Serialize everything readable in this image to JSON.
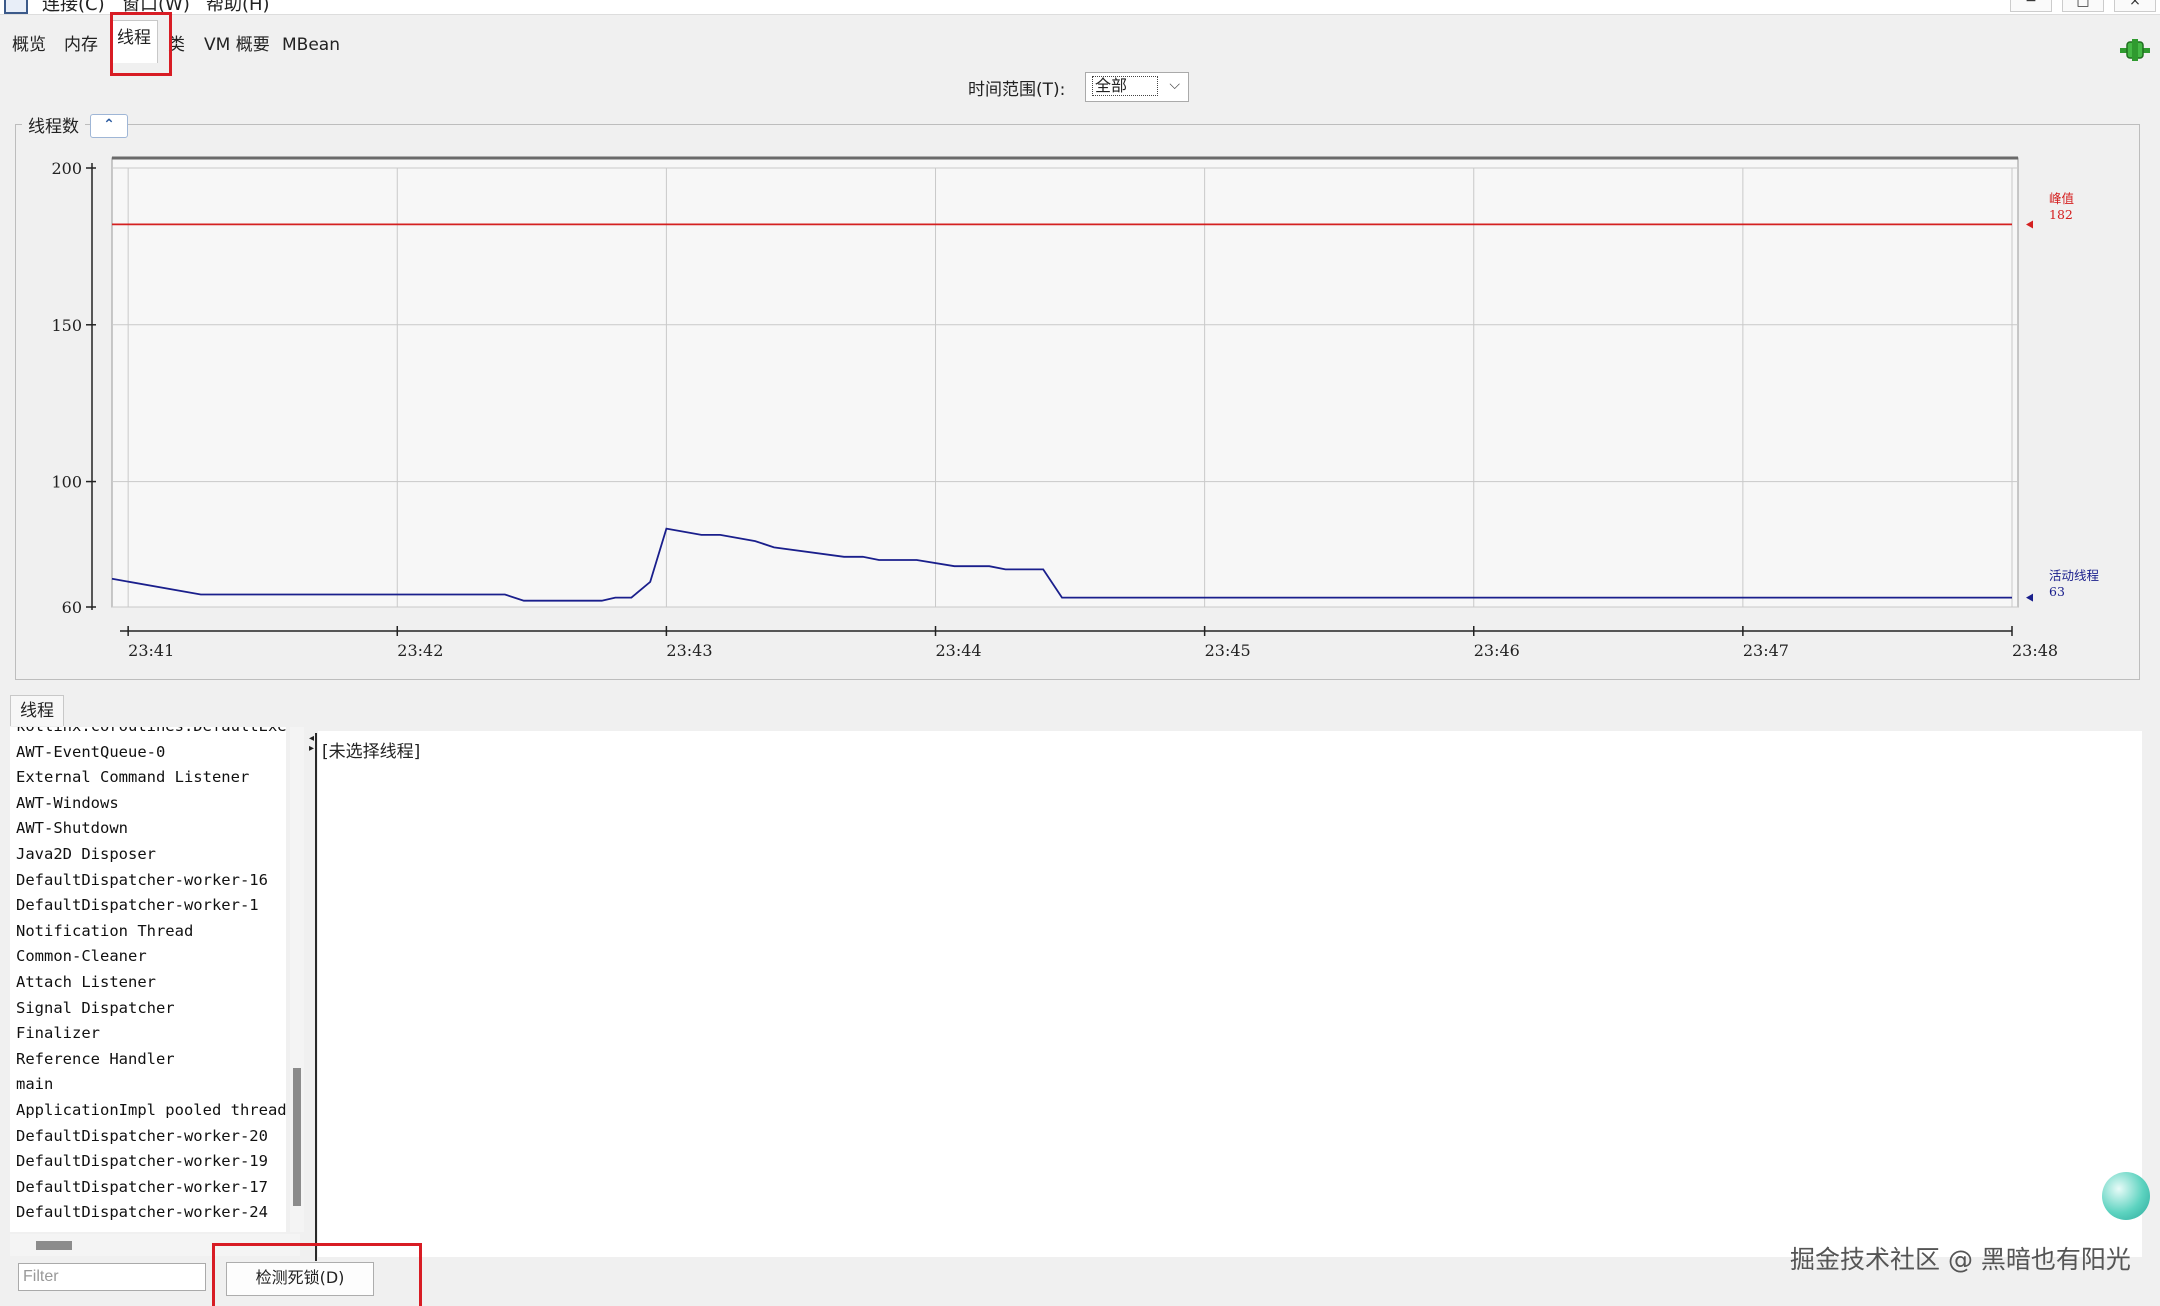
{
  "menubar": {
    "items": [
      "连接(C)",
      "窗口(W)",
      "帮助(H)"
    ],
    "window_buttons": [
      "−",
      "□",
      "×"
    ]
  },
  "tabs": [
    {
      "label": "概览"
    },
    {
      "label": "内存"
    },
    {
      "label": "线程"
    },
    {
      "label": "类"
    },
    {
      "label": "VM 概要"
    },
    {
      "label": "MBean"
    }
  ],
  "active_tab": "线程",
  "time_range": {
    "label": "时间范围(T):",
    "value": "全部"
  },
  "chart_panel": {
    "legend": "线程数",
    "collapse_icon": "double-chevron-up-icon"
  },
  "chart_data": {
    "type": "line",
    "title": "线程数",
    "xlabel": "",
    "ylabel": "",
    "yticks": [
      60,
      100,
      150,
      200
    ],
    "ylim": [
      60,
      200
    ],
    "xticks": [
      "23:41",
      "23:42",
      "23:43",
      "23:44",
      "23:45",
      "23:46",
      "23:47",
      "23:48"
    ],
    "xlim": [
      "23:40.94",
      "23:48"
    ],
    "grid": true,
    "series": [
      {
        "name": "峰值",
        "color": "#d42020",
        "marker_value": "182",
        "points": [
          [
            "23:40.94",
            182
          ],
          [
            "23:48",
            182
          ]
        ]
      },
      {
        "name": "活动线程",
        "color": "#1a1f8c",
        "marker_value": "63",
        "points": [
          [
            "23:40.94",
            69
          ],
          [
            "23:41.27",
            64
          ],
          [
            "23:42.40",
            64
          ],
          [
            "23:42.47",
            62
          ],
          [
            "23:42.76",
            62
          ],
          [
            "23:42.81",
            63
          ],
          [
            "23:42.87",
            63
          ],
          [
            "23:42.94",
            68
          ],
          [
            "23:43.00",
            85
          ],
          [
            "23:43.13",
            83
          ],
          [
            "23:43.20",
            83
          ],
          [
            "23:43.33",
            81
          ],
          [
            "23:43.40",
            79
          ],
          [
            "23:43.66",
            76
          ],
          [
            "23:43.73",
            76
          ],
          [
            "23:43.79",
            75
          ],
          [
            "23:43.93",
            75
          ],
          [
            "23:44.07",
            73
          ],
          [
            "23:44.20",
            73
          ],
          [
            "23:44.26",
            72
          ],
          [
            "23:44.40",
            72
          ],
          [
            "23:44.47",
            63
          ],
          [
            "23:48",
            63
          ]
        ]
      }
    ]
  },
  "threads_panel": {
    "tab_label": "线程",
    "items": [
      "kotlinx.coroutines.DefaultExec",
      "AWT-EventQueue-0",
      "External Command Listener",
      "AWT-Windows",
      "AWT-Shutdown",
      "Java2D Disposer",
      "DefaultDispatcher-worker-16",
      "DefaultDispatcher-worker-1",
      "Notification Thread",
      "Common-Cleaner",
      "Attach Listener",
      "Signal Dispatcher",
      "Finalizer",
      "Reference Handler",
      "main",
      "ApplicationImpl pooled thread",
      "DefaultDispatcher-worker-20",
      "DefaultDispatcher-worker-19",
      "DefaultDispatcher-worker-17",
      "DefaultDispatcher-worker-24"
    ],
    "detail_text": "[未选择线程]",
    "filter_placeholder": "Filter",
    "detect_deadlock_label": "检测死锁(D)"
  },
  "watermark": "掘金技术社区 @ 黑暗也有阳光"
}
